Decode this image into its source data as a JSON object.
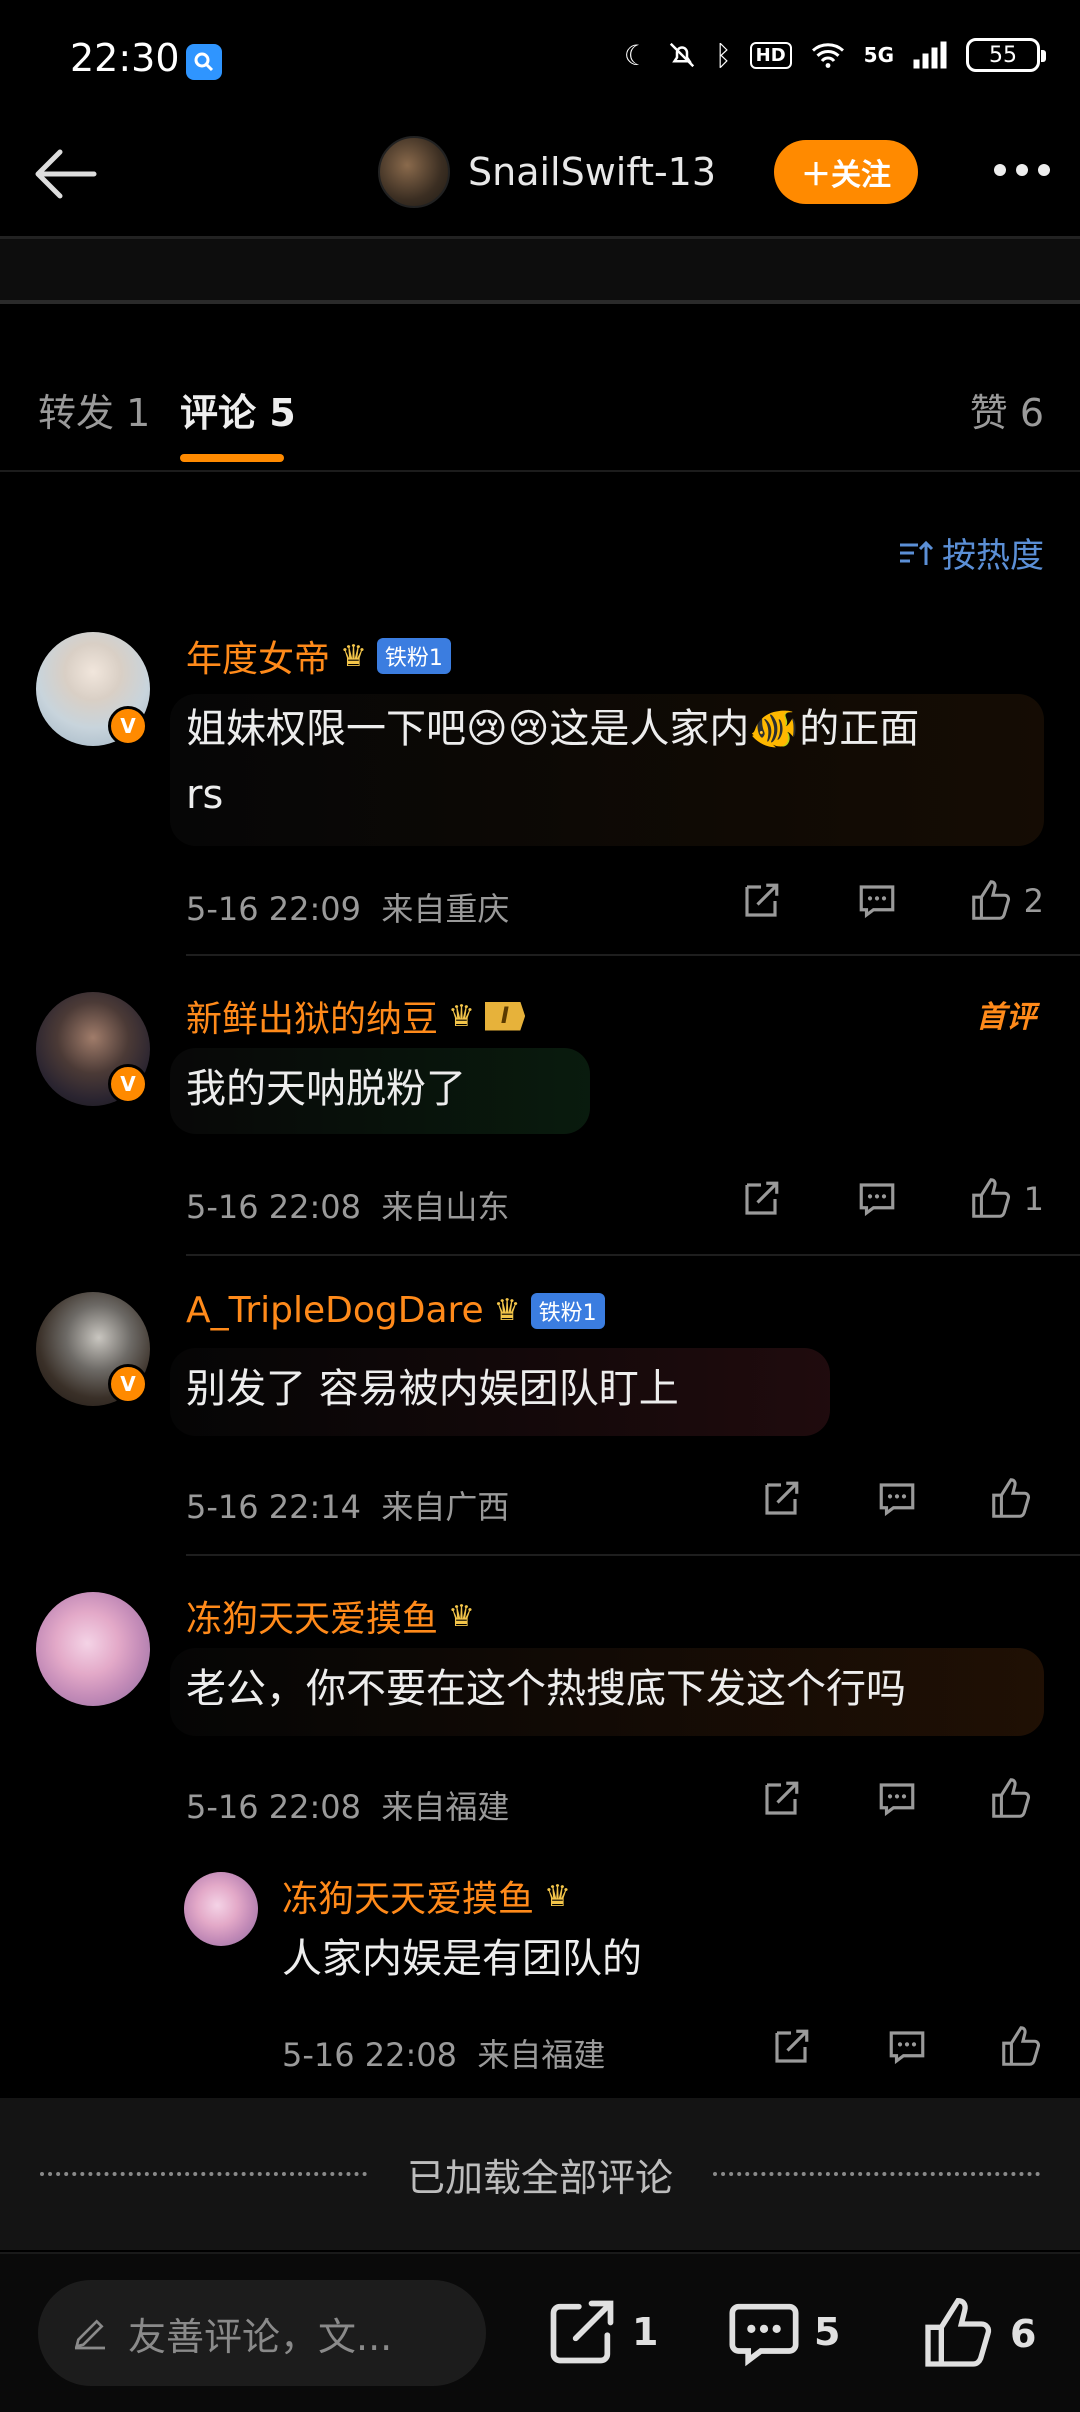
{
  "status_bar": {
    "time": "22:30",
    "network": "5G",
    "hd": "HD",
    "battery": "55"
  },
  "header": {
    "author_name": "SnailSwift-13",
    "follow_label": "＋关注"
  },
  "tabs": [
    {
      "label": "转发 1"
    },
    {
      "label": "评论 5"
    },
    {
      "label": "赞 6"
    }
  ],
  "sort_label": "按热度",
  "comments": [
    {
      "name": "年度女帝",
      "fan_badge": "铁粉1",
      "text_1": "姐妹权限一下吧😢😢这是人家内🐠的正面",
      "text_2": "rs",
      "time": "5-16 22:09",
      "location": "来自重庆",
      "likes": "2"
    },
    {
      "name": "新鲜出狱的纳豆",
      "level_badge": "I",
      "hot": "首评",
      "text": "我的天呐脱粉了",
      "time": "5-16 22:08",
      "location": "来自山东",
      "likes": "1"
    },
    {
      "name": "A_TripleDogDare",
      "fan_badge": "铁粉1",
      "text": "别发了 容易被内娱团队盯上",
      "time": "5-16 22:14",
      "location": "来自广西",
      "likes": ""
    },
    {
      "name": "冻狗天天爱摸鱼",
      "text": "老公，你不要在这个热搜底下发这个行吗",
      "time": "5-16 22:08",
      "location": "来自福建",
      "likes": ""
    }
  ],
  "reply": {
    "name": "冻狗天天爱摸鱼",
    "text": "人家内娱是有团队的",
    "time": "5-16 22:08",
    "location": "来自福建"
  },
  "loaded_all": "已加载全部评论",
  "bottom_bar": {
    "input_placeholder": "友善评论，文...",
    "reposts": "1",
    "comments": "5",
    "likes": "6"
  },
  "colors": {
    "accent": "#ff8a00",
    "link": "#5b8fd6",
    "background": "#000000"
  }
}
